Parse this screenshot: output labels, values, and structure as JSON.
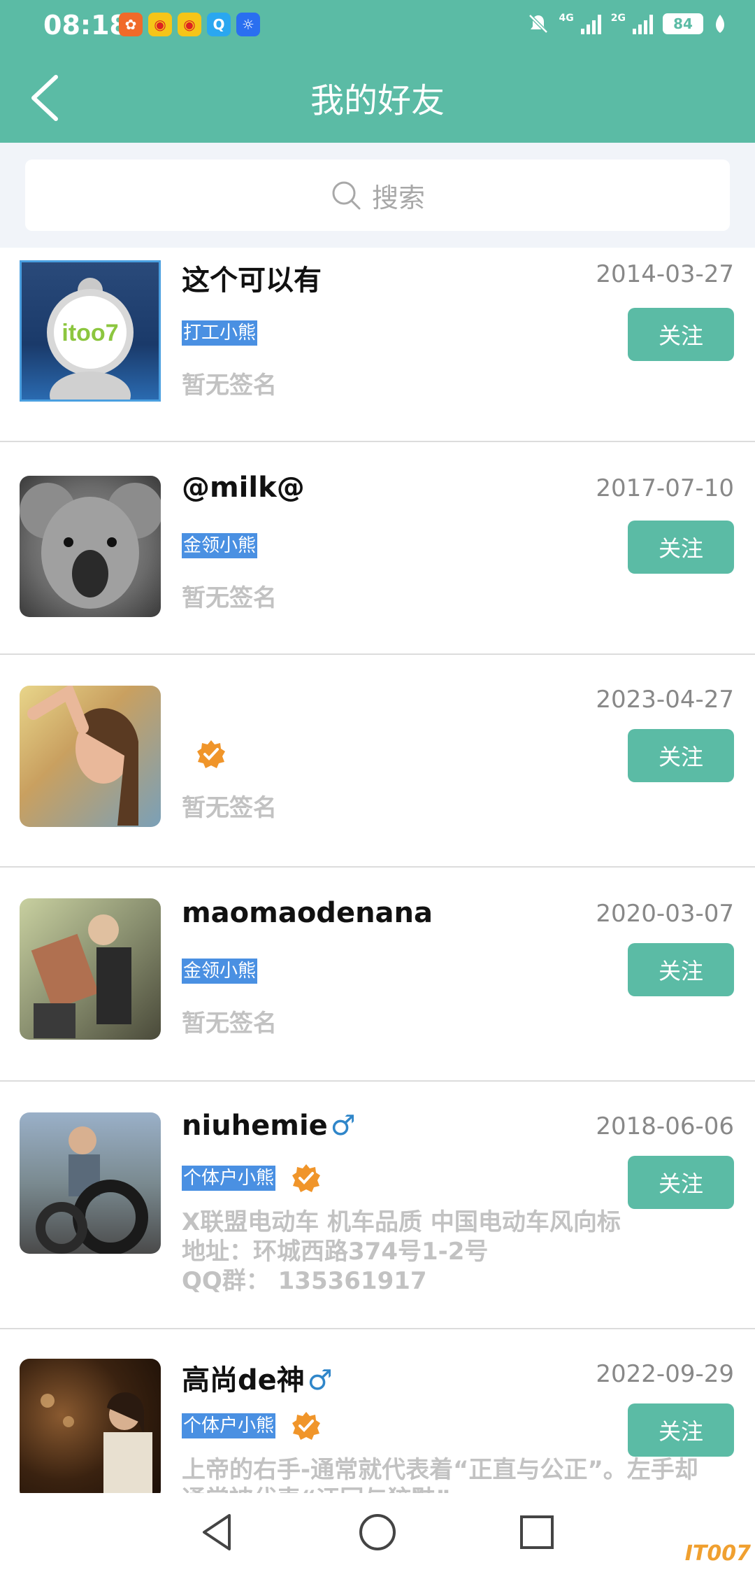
{
  "status_bar": {
    "time": "08:18",
    "net1": "4G",
    "net2": "2G",
    "battery": "84"
  },
  "header": {
    "title": "我的好友"
  },
  "search": {
    "placeholder": "搜索"
  },
  "friends": [
    {
      "name": "这个可以有",
      "gender": "",
      "date": "2014-03-27",
      "tag": "打工小熊",
      "signature": [
        "暂无签名"
      ],
      "follow_label": "关注",
      "verified": false
    },
    {
      "name": "@milk@",
      "gender": "",
      "date": "2017-07-10",
      "tag": "金领小熊",
      "signature": [
        "暂无签名"
      ],
      "follow_label": "关注",
      "verified": false
    },
    {
      "name": "",
      "gender": "",
      "date": "2023-04-27",
      "tag": "",
      "signature": [
        "暂无签名"
      ],
      "follow_label": "关注",
      "verified": true
    },
    {
      "name": "maomaodenana",
      "gender": "",
      "date": "2020-03-07",
      "tag": "金领小熊",
      "signature": [
        "暂无签名"
      ],
      "follow_label": "关注",
      "verified": false
    },
    {
      "name": "niuhemie",
      "gender": "♂",
      "date": "2018-06-06",
      "tag": "个体户小熊",
      "signature": [
        "X联盟电动车 机车品质 中国电动车风向标",
        "地址：环城西路374号1-2号",
        "QQ群：  135361917"
      ],
      "follow_label": "关注",
      "verified": true
    },
    {
      "name": "高尚de神",
      "gender": "♂",
      "date": "2022-09-29",
      "tag": "个体户小熊",
      "signature": [
        "上帝的右手-通常就代表着“正直与公正”。左手却",
        "通常被代表“迂回与狡黠”"
      ],
      "follow_label": "关注",
      "verified": true
    }
  ],
  "watermark": "IT007",
  "colors": {
    "primary": "#5bbba5",
    "tag_bg": "#4a90e2",
    "badge": "#f0952a"
  }
}
